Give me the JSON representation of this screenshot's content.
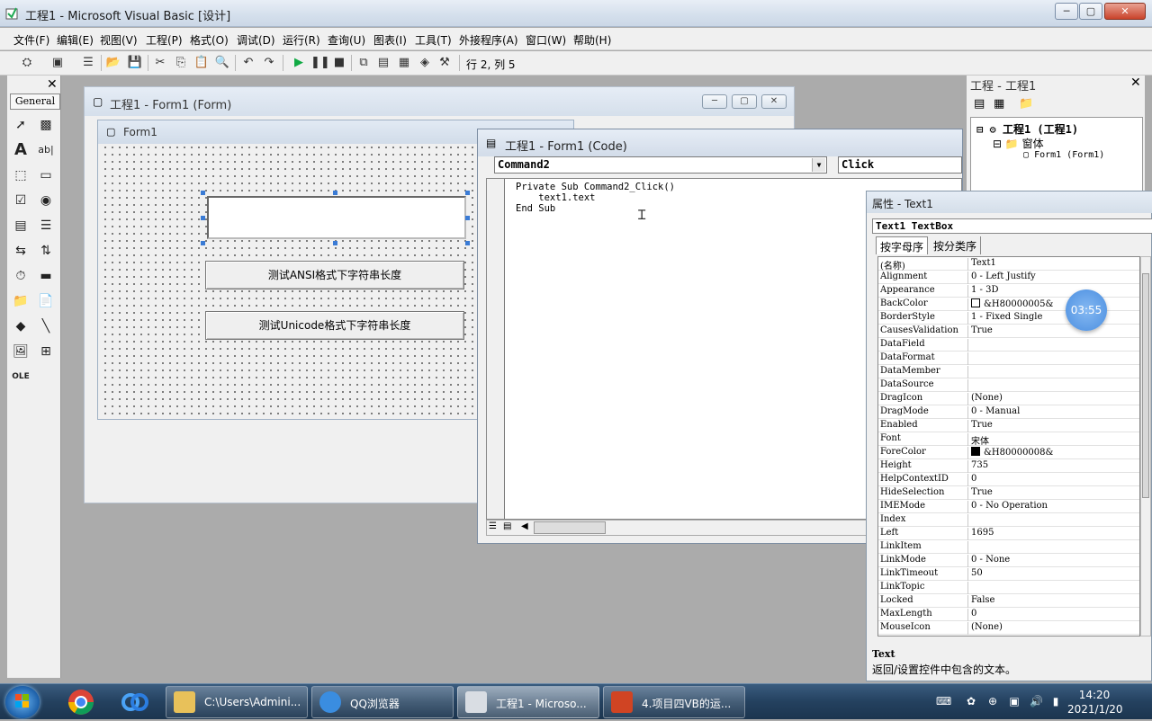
{
  "window": {
    "title": "工程1 - Microsoft Visual Basic [设计]",
    "min": "─",
    "max": "▢",
    "close": "✕"
  },
  "menu": [
    "文件(F)",
    "编辑(E)",
    "视图(V)",
    "工程(P)",
    "格式(O)",
    "调试(D)",
    "运行(R)",
    "查询(U)",
    "图表(I)",
    "工具(T)",
    "外接程序(A)",
    "窗口(W)",
    "帮助(H)"
  ],
  "toolbar": {
    "position": "行 2, 列 5"
  },
  "toolbox": {
    "tab": "General",
    "close": "✕"
  },
  "form_designer": {
    "title": "工程1 - Form1 (Form)",
    "form_caption": "Form1",
    "button1": "测试ANSI格式下字符串长度",
    "button2": "测试Unicode格式下字符串长度"
  },
  "code_window": {
    "title": "工程1 - Form1 (Code)",
    "object": "Command2",
    "procedure": "Click",
    "lines": [
      "Private Sub Command2_Click()",
      "    text1.text",
      "End Sub"
    ]
  },
  "project": {
    "title": "工程 - 工程1",
    "root": "工程1 (工程1)",
    "folder": "窗体",
    "item": "Form1 (Form1)"
  },
  "properties": {
    "title": "属性 - Text1",
    "object": "Text1 TextBox",
    "tab_alpha": "按字母序",
    "tab_category": "按分类序",
    "rows": [
      {
        "name": "(名称)",
        "value": "Text1"
      },
      {
        "name": "Alignment",
        "value": "0 - Left Justify"
      },
      {
        "name": "Appearance",
        "value": "1 - 3D"
      },
      {
        "name": "BackColor",
        "value": "&H80000005&"
      },
      {
        "name": "BorderStyle",
        "value": "1 - Fixed Single"
      },
      {
        "name": "CausesValidation",
        "value": "True"
      },
      {
        "name": "DataField",
        "value": ""
      },
      {
        "name": "DataFormat",
        "value": ""
      },
      {
        "name": "DataMember",
        "value": ""
      },
      {
        "name": "DataSource",
        "value": ""
      },
      {
        "name": "DragIcon",
        "value": "(None)"
      },
      {
        "name": "DragMode",
        "value": "0 - Manual"
      },
      {
        "name": "Enabled",
        "value": "True"
      },
      {
        "name": "Font",
        "value": "宋体"
      },
      {
        "name": "ForeColor",
        "value": "&H80000008&"
      },
      {
        "name": "Height",
        "value": "735"
      },
      {
        "name": "HelpContextID",
        "value": "0"
      },
      {
        "name": "HideSelection",
        "value": "True"
      },
      {
        "name": "IMEMode",
        "value": "0 - No Operation"
      },
      {
        "name": "Index",
        "value": ""
      },
      {
        "name": "Left",
        "value": "1695"
      },
      {
        "name": "LinkItem",
        "value": ""
      },
      {
        "name": "LinkMode",
        "value": "0 - None"
      },
      {
        "name": "LinkTimeout",
        "value": "50"
      },
      {
        "name": "LinkTopic",
        "value": ""
      },
      {
        "name": "Locked",
        "value": "False"
      },
      {
        "name": "MaxLength",
        "value": "0"
      },
      {
        "name": "MouseIcon",
        "value": "(None)"
      }
    ],
    "desc_title": "Text",
    "desc_text": "返回/设置控件中包含的文本。",
    "backcolor_swatch": "#ffffff",
    "forecolor_swatch": "#000000"
  },
  "timer_badge": "03:55",
  "taskbar": {
    "items": [
      "C:\\Users\\Admini...",
      "QQ浏览器",
      "工程1 - Microso...",
      "4.项目四VB的运..."
    ],
    "time": "14:20",
    "date": "2021/1/20"
  }
}
